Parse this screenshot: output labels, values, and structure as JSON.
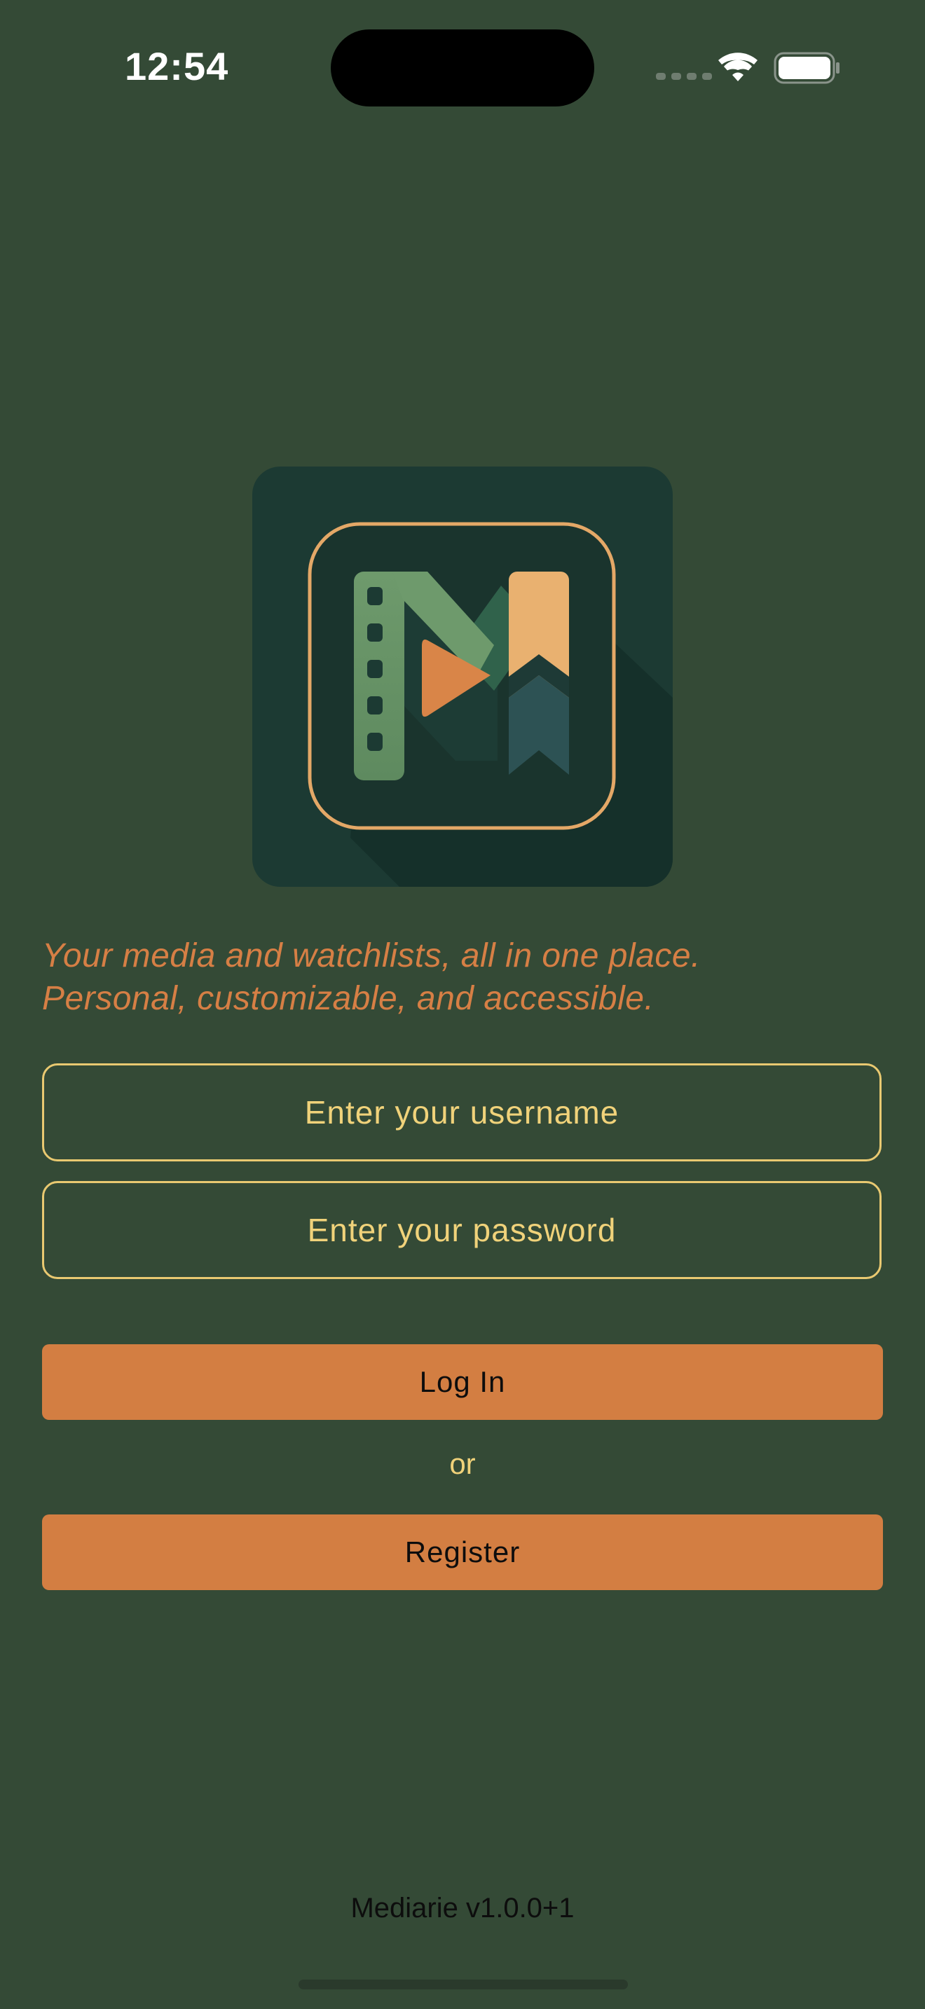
{
  "status_bar": {
    "time": "12:54"
  },
  "app": {
    "tagline_line1": "Your media and watchlists, all in one place.",
    "tagline_line2": "Personal, customizable, and accessible.",
    "username_placeholder": "Enter your username",
    "password_placeholder": "Enter your password",
    "login_label": "Log In",
    "or_label": "or",
    "register_label": "Register",
    "version": "Mediarie v1.0.0+1"
  },
  "colors": {
    "background": "#344a36",
    "accent": "#d37e42",
    "field_border": "#e9c971",
    "placeholder_text": "#f0d27a",
    "logo_bg": "#1c3a33"
  },
  "icons": [
    "wifi-icon",
    "battery-icon",
    "cellular-signal-icon",
    "app-logo"
  ]
}
